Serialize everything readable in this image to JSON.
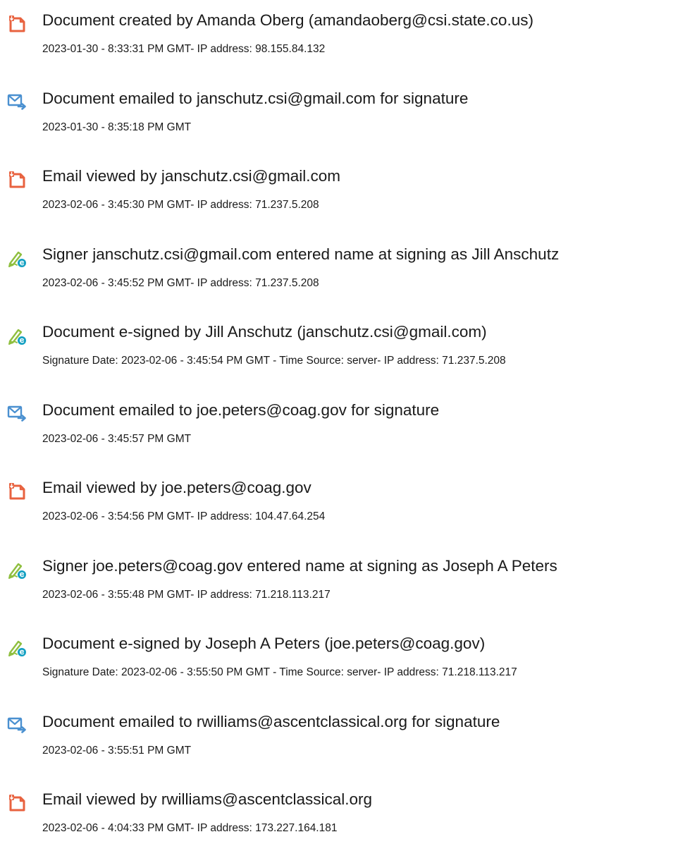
{
  "icons": {
    "created": "document-created-icon",
    "emailed": "email-sent-icon",
    "viewed": "email-viewed-icon",
    "signed": "e-sign-pen-icon"
  },
  "colors": {
    "document_icon": "#e8623f",
    "mail_icon": "#4a90d0",
    "signature_pen": "#8fbf3f",
    "signature_badge": "#14a0c2"
  },
  "events": [
    {
      "type": "created",
      "title": "Document created by Amanda Oberg (amandaoberg@csi.state.co.us)",
      "detail": "2023-01-30 - 8:33:31 PM GMT- IP address: 98.155.84.132"
    },
    {
      "type": "emailed",
      "title": "Document emailed to janschutz.csi@gmail.com for signature",
      "detail": "2023-01-30 - 8:35:18 PM GMT"
    },
    {
      "type": "viewed",
      "title": "Email viewed by janschutz.csi@gmail.com",
      "detail": "2023-02-06 - 3:45:30 PM GMT- IP address: 71.237.5.208"
    },
    {
      "type": "signed",
      "title": "Signer janschutz.csi@gmail.com entered name at signing as Jill Anschutz",
      "detail": "2023-02-06 - 3:45:52 PM GMT- IP address: 71.237.5.208"
    },
    {
      "type": "signed",
      "title": "Document e-signed by Jill Anschutz (janschutz.csi@gmail.com)",
      "detail": "Signature Date: 2023-02-06 - 3:45:54 PM GMT - Time Source: server- IP address: 71.237.5.208"
    },
    {
      "type": "emailed",
      "title": "Document emailed to joe.peters@coag.gov for signature",
      "detail": "2023-02-06 - 3:45:57 PM GMT"
    },
    {
      "type": "viewed",
      "title": "Email viewed by joe.peters@coag.gov",
      "detail": "2023-02-06 - 3:54:56 PM GMT- IP address: 104.47.64.254"
    },
    {
      "type": "signed",
      "title": "Signer joe.peters@coag.gov entered name at signing as Joseph A Peters",
      "detail": "2023-02-06 - 3:55:48 PM GMT- IP address: 71.218.113.217"
    },
    {
      "type": "signed",
      "title": "Document e-signed by Joseph A Peters (joe.peters@coag.gov)",
      "detail": "Signature Date: 2023-02-06 - 3:55:50 PM GMT - Time Source: server- IP address: 71.218.113.217"
    },
    {
      "type": "emailed",
      "title": "Document emailed to rwilliams@ascentclassical.org for signature",
      "detail": "2023-02-06 - 3:55:51 PM GMT"
    },
    {
      "type": "viewed",
      "title": "Email viewed by rwilliams@ascentclassical.org",
      "detail": "2023-02-06 - 4:04:33 PM GMT- IP address: 173.227.164.181"
    }
  ]
}
